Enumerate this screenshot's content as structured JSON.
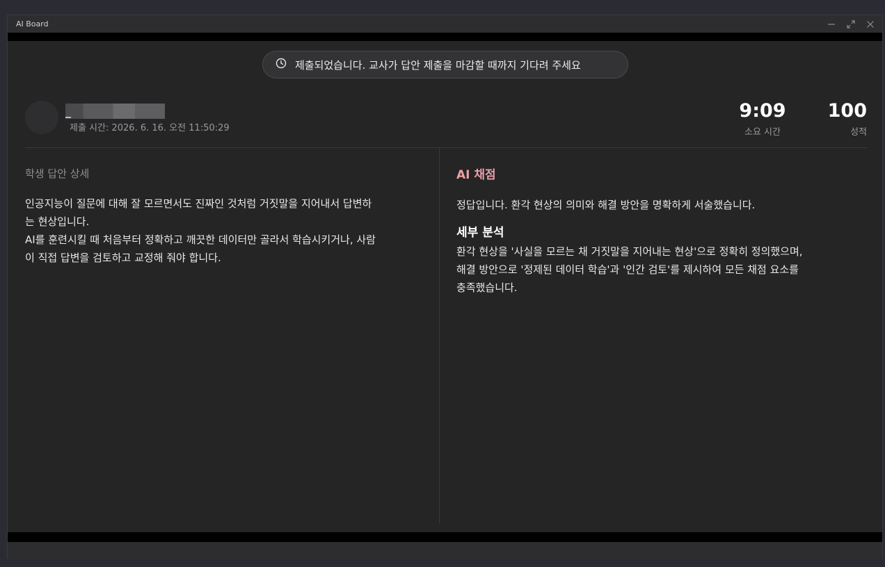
{
  "window": {
    "title": "AI Board"
  },
  "notice": {
    "icon": "clock-icon",
    "text": "제출되었습니다. 교사가 답안 제출을 마감할 때까지 기다려 주세요"
  },
  "student": {
    "submit_time": "제출 시간: 2026. 6. 16. 오전 11:50:29"
  },
  "stats": {
    "time_value": "9:09",
    "time_label": "소요 시간",
    "score_value": "100",
    "score_label": "성적"
  },
  "left": {
    "heading": "학생 답안 상세",
    "answer_lines": [
      "인공지능이 질문에 대해 잘 모르면서도 진짜인 것처럼 거짓말을 지어내서 답변하",
      "는 현상입니다.",
      "AI를 훈련시킬 때 처음부터 정확하고 깨끗한 데이터만 골라서 학습시키거나, 사람",
      "이 직접 답변을 검토하고 교정해 줘야 합니다."
    ]
  },
  "right": {
    "title": "AI 채점",
    "verdict": "정답입니다. 환각 현상의 의미와 해결 방안을 명확하게 서술했습니다.",
    "detail_heading": "세부 분석",
    "detail_lines": [
      "환각 현상을 '사실을 모르는 채 거짓말을 지어내는 현상'으로 정확히 정의했으며,",
      "해결 방안으로 '정제된 데이터 학습'과 '인간 검토'를 제시하여 모든 채점 요소를",
      "충족했습니다."
    ]
  }
}
